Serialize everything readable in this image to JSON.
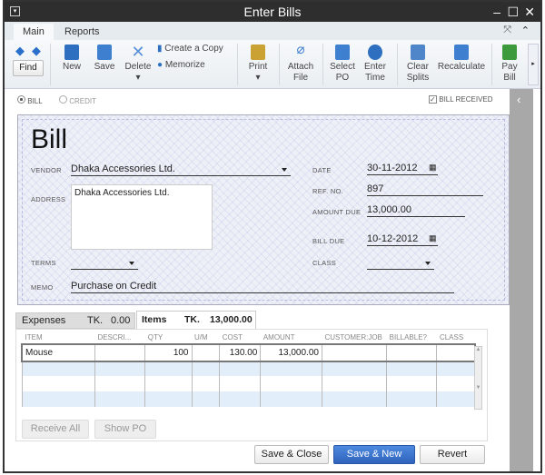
{
  "window": {
    "title": "Enter Bills"
  },
  "ribbon_tabs": [
    "Main",
    "Reports"
  ],
  "ribbon": {
    "find": "Find",
    "new": "New",
    "save": "Save",
    "delete": "Delete",
    "create_copy": "Create a Copy",
    "memorize": "Memorize",
    "print": "Print",
    "attach": "Attach File",
    "select_po": "Select PO",
    "enter_time": "Enter Time",
    "clear_splits": "Clear Splits",
    "recalculate": "Recalculate",
    "pay_bill": "Pay Bill"
  },
  "mode": {
    "bill": "BILL",
    "credit": "CREDIT",
    "selected": "BILL",
    "bill_received": "BILL RECEIVED",
    "bill_received_checked": true
  },
  "form": {
    "title": "Bill",
    "vendor_label": "VENDOR",
    "vendor": "Dhaka Accessories Ltd.",
    "address_label": "ADDRESS",
    "address": "Dhaka Accessories Ltd.",
    "terms_label": "TERMS",
    "terms": "",
    "memo_label": "MEMO",
    "memo": "Purchase on Credit",
    "date_label": "DATE",
    "date": "30-11-2012",
    "ref_label": "REF. NO.",
    "ref": "897",
    "amount_due_label": "AMOUNT DUE",
    "amount_due": "13,000.00",
    "bill_due_label": "BILL DUE",
    "bill_due": "10-12-2012",
    "class_label": "CLASS",
    "class": ""
  },
  "detail_tabs": [
    {
      "label": "Expenses",
      "currency": "TK.",
      "amount": "0.00"
    },
    {
      "label": "Items",
      "currency": "TK.",
      "amount": "13,000.00",
      "active": true
    }
  ],
  "items_table": {
    "columns": [
      "ITEM",
      "DESCRI...",
      "QTY",
      "U/M",
      "COST",
      "AMOUNT",
      "CUSTOMER:JOB",
      "BILLABLE?",
      "CLASS"
    ],
    "rows": [
      [
        "Mouse",
        "",
        "100",
        "",
        "130.00",
        "13,000.00",
        "",
        "",
        ""
      ]
    ]
  },
  "buttons": {
    "receive_all": "Receive All",
    "show_po": "Show PO",
    "save_close": "Save & Close",
    "save_new": "Save & New",
    "revert": "Revert"
  },
  "colors": {
    "accent": "#3a74c9",
    "title_bar": "#2e2e2e"
  }
}
